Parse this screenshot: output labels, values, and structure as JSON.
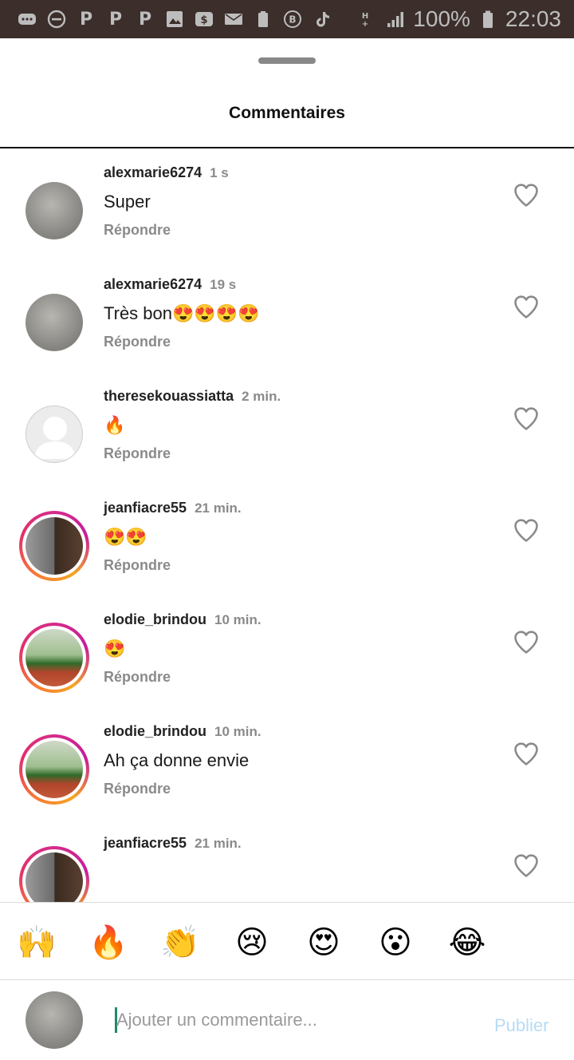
{
  "status_bar": {
    "icons": [
      "message-icon",
      "dnd-icon",
      "p-app-icon",
      "p-app-icon",
      "p-app-icon",
      "gallery-icon",
      "money-app-icon",
      "mail-icon",
      "battery-saver-icon",
      "b-app-icon",
      "tiktok-icon",
      "hplus-signal-icon",
      "signal-icon"
    ],
    "p_letter": "P",
    "battery_percent": "100%",
    "battery_icon": "battery-icon",
    "time": "22:03"
  },
  "sheet": {
    "title": "Commentaires"
  },
  "comments": [
    {
      "username": "alexmarie6274",
      "time": "1 s",
      "text": "Super",
      "reply_label": "Répondre",
      "avatar": "bird",
      "story_ring": false
    },
    {
      "username": "alexmarie6274",
      "time": "19 s",
      "text": "Très bon😍😍😍😍",
      "reply_label": "Répondre",
      "avatar": "bird",
      "story_ring": false
    },
    {
      "username": "theresekouassiatta",
      "time": "2 min.",
      "text": "🔥",
      "reply_label": "Répondre",
      "avatar": "default",
      "story_ring": false
    },
    {
      "username": "jeanfiacre55",
      "time": "21 min.",
      "text": "😍😍",
      "reply_label": "Répondre",
      "avatar": "man",
      "story_ring": true
    },
    {
      "username": "elodie_brindou",
      "time": "10 min.",
      "text": "😍",
      "reply_label": "Répondre",
      "avatar": "scene",
      "story_ring": true
    },
    {
      "username": "elodie_brindou",
      "time": "10 min.",
      "text": "Ah ça donne envie",
      "reply_label": "Répondre",
      "avatar": "scene",
      "story_ring": true
    },
    {
      "username": "jeanfiacre55",
      "time": "21 min.",
      "text": "",
      "reply_label": "",
      "avatar": "man",
      "story_ring": true
    }
  ],
  "reactions": [
    "🙌",
    "🔥",
    "👏",
    "😢",
    "😍",
    "😮",
    "😂"
  ],
  "composer": {
    "placeholder": "Ajouter un commentaire...",
    "value": "",
    "post_label": "Publier"
  },
  "colors": {
    "status_bar_bg": "#3b2e2b",
    "post_disabled": "#b7dbf5",
    "secondary_text": "#8a8a8a",
    "cursor": "#1b8a6b"
  }
}
